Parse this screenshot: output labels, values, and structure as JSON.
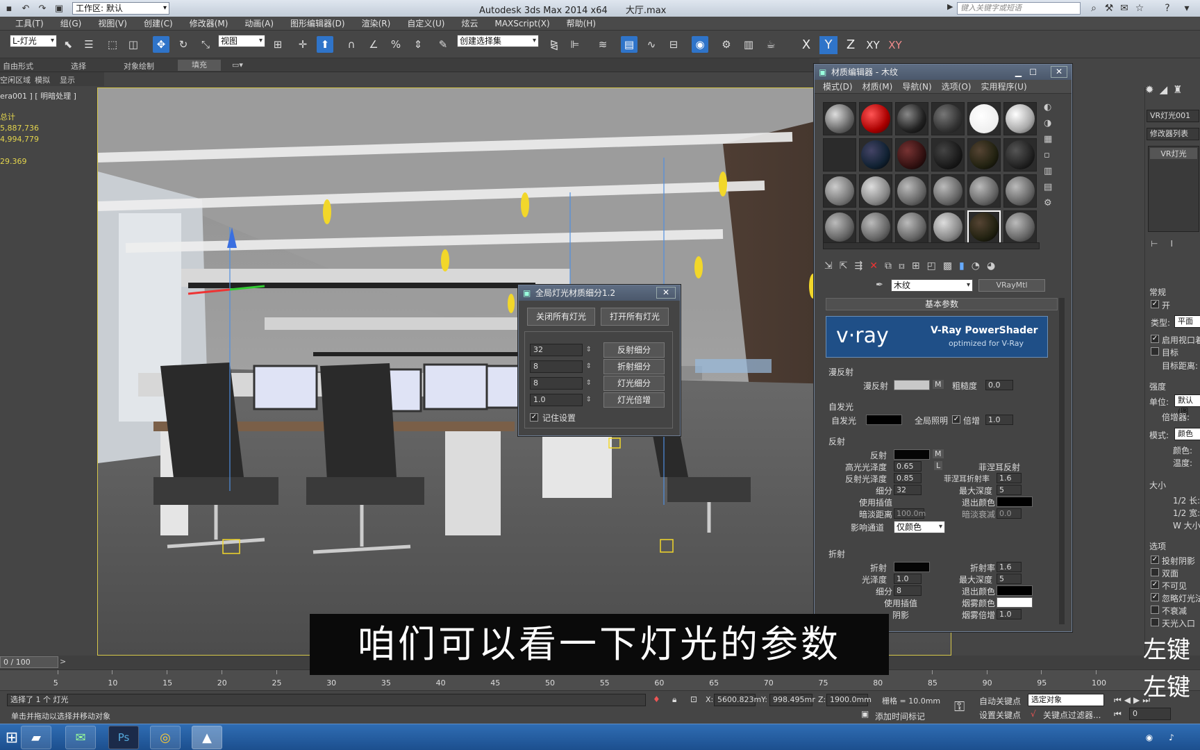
{
  "titlebar": {
    "workspace": "工作区: 默认",
    "app_title": "Autodesk 3ds Max  2014 x64",
    "file_name": "大厅.max",
    "search_placeholder": "键入关键字或短语"
  },
  "menu": [
    "工具(T)",
    "组(G)",
    "视图(V)",
    "创建(C)",
    "修改器(M)",
    "动画(A)",
    "图形编辑器(D)",
    "渲染(R)",
    "自定义(U)",
    "炫云",
    "MAXScript(X)",
    "帮助(H)"
  ],
  "toolbar": {
    "selection_filter": "L-灯光",
    "ref_coord": "视图",
    "named_selection": "创建选择集",
    "axis": [
      "X",
      "Y",
      "Z",
      "XY",
      "XY"
    ]
  },
  "ribbon": {
    "tabs": [
      "自由形式",
      "选择",
      "对象绘制",
      "填充"
    ],
    "subtabs": [
      "空闲区域",
      "模拟",
      "显示"
    ]
  },
  "viewport": {
    "label": "era001 ] [ 明暗处理 ]",
    "stats_title": "总计",
    "stats": [
      "5,887,736",
      "4,994,779",
      "29.369"
    ]
  },
  "light_dialog": {
    "title": "全局灯光材质细分1.2",
    "close_all": "关闭所有灯光",
    "open_all": "打开所有灯光",
    "rows": [
      {
        "value": "32",
        "button": "反射细分"
      },
      {
        "value": "8",
        "button": "折射细分"
      },
      {
        "value": "8",
        "button": "灯光细分"
      },
      {
        "value": "1.0",
        "button": "灯光倍增"
      }
    ],
    "remember": "记住设置"
  },
  "material_editor": {
    "title": "材质编辑器 - 木纹",
    "menu": [
      "模式(D)",
      "材质(M)",
      "导航(N)",
      "选项(O)",
      "实用程序(U)"
    ],
    "material_name": "木纹",
    "material_type": "VRayMtl",
    "rollout": "基本参数",
    "banner_logo": "v·ray",
    "banner_title": "V-Ray PowerShader",
    "banner_sub": "optimized for V-Ray",
    "diffuse": {
      "group": "漫反射",
      "label": "漫反射",
      "m": "M",
      "rough_label": "粗糙度",
      "rough": "0.0"
    },
    "selfillum": {
      "group": "自发光",
      "label": "自发光",
      "gi": "全局照明",
      "mult_label": "倍增",
      "mult": "1.0"
    },
    "reflect": {
      "group": "反射",
      "label": "反射",
      "m": "M",
      "hilight_label": "高光光泽度",
      "hilight": "0.65",
      "l": "L",
      "fresnel_label": "菲涅耳反射",
      "gloss_label": "反射光泽度",
      "gloss": "0.85",
      "fior_label": "菲涅耳折射率",
      "fior": "1.6",
      "subdiv_label": "细分",
      "subdiv": "32",
      "maxdepth_label": "最大深度",
      "maxdepth": "5",
      "interp_label": "使用插值",
      "exit_label": "退出颜色",
      "dimdist_label": "暗淡距离",
      "dimdist": "100.0m",
      "dimfall_label": "暗淡衰减",
      "dimfall": "0.0",
      "affect_label": "影响通道",
      "affect": "仅颜色"
    },
    "refract": {
      "group": "折射",
      "label": "折射",
      "ior_label": "折射率",
      "ior": "1.6",
      "gloss_label": "光泽度",
      "gloss": "1.0",
      "maxdepth_label": "最大深度",
      "maxdepth": "5",
      "subdiv_label": "细分",
      "subdiv": "8",
      "exit_label": "退出颜色",
      "interp_label": "使用插值",
      "fog_label": "烟雾颜色",
      "shadow_label": "阴影",
      "fogmult_label": "烟雾倍增",
      "fogmult": "1.0"
    }
  },
  "command_panel": {
    "object_name": "VR灯光001",
    "modifier_list": "修改器列表",
    "stack_item": "VR灯光",
    "general": "常规",
    "on": "开",
    "type_label": "类型:",
    "type_value": "平面",
    "enable_vp": "启用视口着",
    "target": "目标",
    "target_dist": "目标距离:",
    "intensity": "强度",
    "units_label": "单位:",
    "units_value": "默认(图",
    "multiplier": "倍增器:",
    "mode_label": "模式:",
    "mode_value": "颜色",
    "color": "颜色:",
    "temp": "温度:",
    "size": "大小",
    "half_len": "1/2 长:",
    "half_wid": "1/2 宽:",
    "w_size": "W 大小",
    "options": "选项",
    "cast_shadow": "投射阴影",
    "double_sided": "双面",
    "invisible": "不可见",
    "ignore_normals": "忽略灯光法",
    "no_decay": "不衰减",
    "skylight_portal": "天光入口"
  },
  "timeline": {
    "frame": "0 / 100",
    "ticks": [
      "5",
      "10",
      "15",
      "20",
      "25",
      "30",
      "35",
      "40",
      "45",
      "50",
      "55",
      "60",
      "65",
      "70",
      "75",
      "80",
      "85",
      "90",
      "95",
      "100"
    ]
  },
  "status": {
    "selected": "选择了 1 个 灯光",
    "prompt": "单击并拖动以选择并移动对象",
    "x_label": "X:",
    "x": "5600.823m",
    "y_label": "Y:",
    "y": "998.495mr",
    "z_label": "Z:",
    "z": "1900.0mm",
    "grid": "栅格 = 10.0mm",
    "add_time_tag": "添加时间标记",
    "auto_key": "自动关键点",
    "set_key": "设置关键点",
    "selected_obj": "选定对象",
    "key_filter": "关键点过滤器...",
    "frame_field": "0"
  },
  "subtitle": "咱们可以看一下灯光的参数",
  "hints": [
    "左键",
    "左键"
  ]
}
